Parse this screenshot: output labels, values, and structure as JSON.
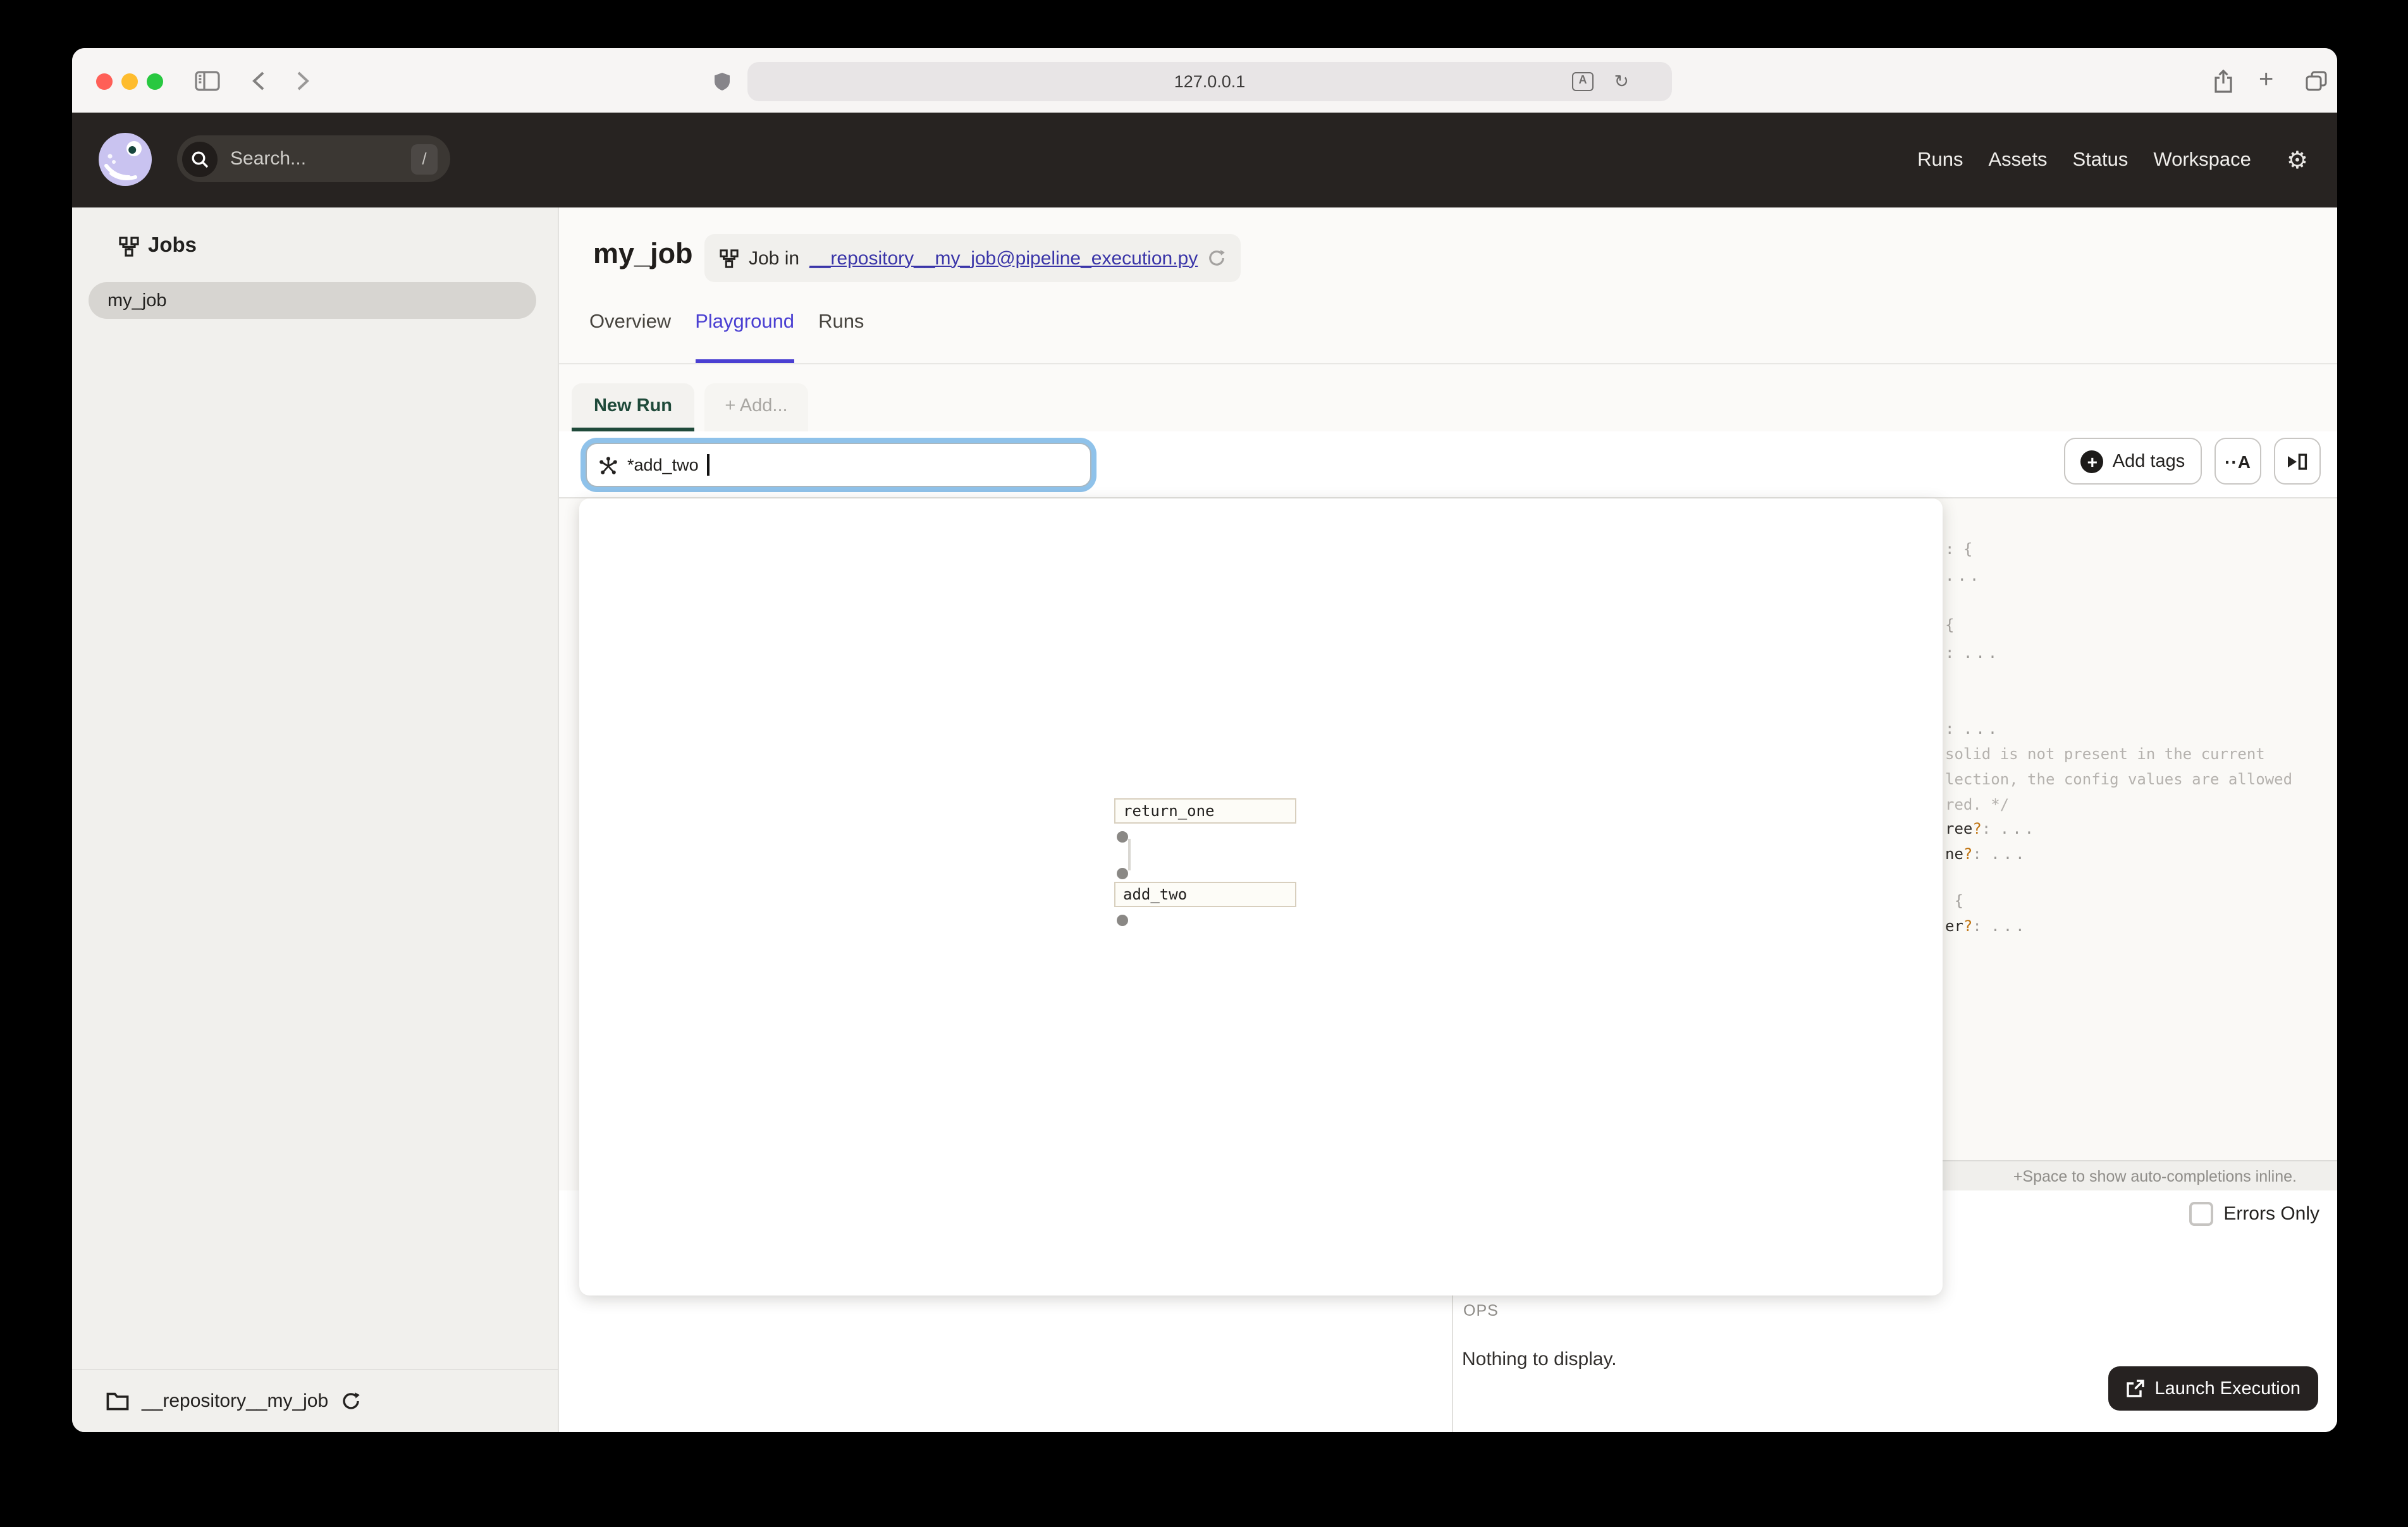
{
  "browser": {
    "url": "127.0.0.1"
  },
  "app_header": {
    "search_placeholder": "Search...",
    "search_shortcut": "/",
    "nav": [
      {
        "label": "Runs"
      },
      {
        "label": "Assets"
      },
      {
        "label": "Status"
      },
      {
        "label": "Workspace"
      }
    ]
  },
  "sidebar": {
    "title": "Jobs",
    "items": [
      {
        "label": "my_job",
        "selected": true
      }
    ],
    "footer_repo": "__repository__my_job"
  },
  "page": {
    "title": "my_job",
    "badge_prefix": "Job in",
    "badge_link": "__repository__my_job@pipeline_execution.py",
    "tabs": [
      {
        "label": "Overview",
        "active": false
      },
      {
        "label": "Playground",
        "active": true
      },
      {
        "label": "Runs",
        "active": false
      }
    ]
  },
  "run_tabs": {
    "new_run": "New Run",
    "add": "+ Add..."
  },
  "op_selector": {
    "value": "*add_two"
  },
  "toolbar": {
    "add_tags": "Add tags",
    "scaffold_glyph": "··A"
  },
  "graph": {
    "nodes": [
      {
        "label": "return_one"
      },
      {
        "label": "add_two"
      }
    ]
  },
  "config_editor": {
    "hint": "+Space to show auto-completions inline.",
    "lines": [
      {
        "parts": [
          [
            "p",
            ": {"
          ]
        ]
      },
      {
        "parts": [
          [
            "d",
            "..."
          ]
        ]
      },
      {
        "parts": [
          [
            "p",
            "{"
          ]
        ]
      },
      {
        "parts": [
          [
            "p",
            ": "
          ],
          [
            "d",
            "..."
          ]
        ]
      },
      {
        "parts": [
          [
            "p",
            ": "
          ],
          [
            "d",
            "..."
          ]
        ]
      },
      {
        "parts": [
          [
            "c",
            "solid is not present in the current"
          ]
        ]
      },
      {
        "parts": [
          [
            "c",
            "lection, the config values are allowed"
          ]
        ]
      },
      {
        "parts": [
          [
            "c",
            "red. */"
          ]
        ]
      },
      {
        "parts": [
          [
            "n",
            "ree"
          ],
          [
            "q",
            "?"
          ],
          [
            "p",
            ": "
          ],
          [
            "d",
            "..."
          ]
        ]
      },
      {
        "parts": [
          [
            "n",
            "ne"
          ],
          [
            "q",
            "?"
          ],
          [
            "p",
            ": "
          ],
          [
            "d",
            "..."
          ]
        ]
      },
      {
        "parts": [
          [
            "p",
            " {"
          ]
        ]
      },
      {
        "parts": [
          [
            "n",
            "er"
          ],
          [
            "q",
            "?"
          ],
          [
            "p",
            ": "
          ],
          [
            "d",
            "..."
          ]
        ]
      }
    ]
  },
  "ops_panel": {
    "errors_only": "Errors Only",
    "heading": "OPS",
    "empty": "Nothing to display.",
    "launch": "Launch Execution"
  },
  "colors": {
    "accent_playground": "#4a3fd2",
    "badge_link": "#3a35a8",
    "new_run_green": "#1f4a3a",
    "focus_ring": "#8fc2ea",
    "launch_button_bg": "#262221",
    "question_mark_orange": "#c0730f"
  }
}
